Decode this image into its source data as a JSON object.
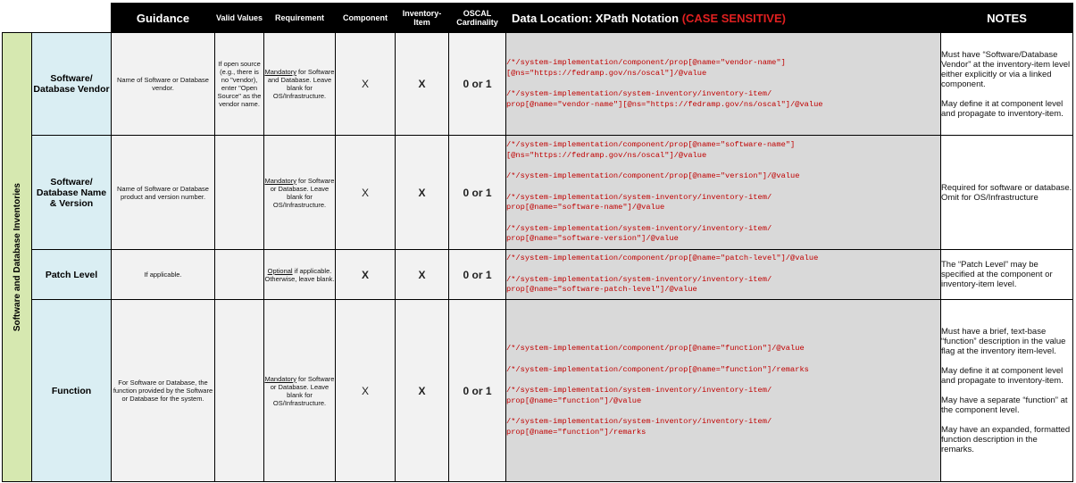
{
  "header": {
    "guidance": "Guidance",
    "valid_values": "Valid Values",
    "requirement": "Requirement",
    "component": "Component",
    "inventory_item": "Inventory-Item",
    "oscal_cardinality": "OSCAL Cardinality",
    "xpath_title": "Data Location: XPath Notation",
    "xpath_case": "(CASE SENSITIVE)",
    "notes": "NOTES"
  },
  "section_label": "Software and Database Inventories",
  "rows": [
    {
      "name": "Software/ Database Vendor",
      "guidance": "Name of Software or Database vendor.",
      "valid_values": "If open source (e.g., there is no \"vendor), enter \"Open Source\" as the vendor name.",
      "req_keyword": "Mandatory",
      "req_rest": " for Software and Database. Leave blank for OS/Infrastructure.",
      "component": "X",
      "inventory": "X",
      "cardinality": "0 or 1",
      "xpaths": [
        "/*/system-implementation/component/prop[@name=\"vendor-name\"]\n[@ns=\"https://fedramp.gov/ns/oscal\"]/@value",
        "/*/system-implementation/system-inventory/inventory-item/\nprop[@name=\"vendor-name\"][@ns=\"https://fedramp.gov/ns/oscal\"]/@value"
      ],
      "notes": [
        "Must have “Software/Database Vendor” at the inventory-item level either explicitly or via a linked component.",
        "May define it at component level and propagate to inventory-item."
      ]
    },
    {
      "name": "Software/ Database Name & Version",
      "guidance": "Name of Software or Database product and version number.",
      "valid_values": "",
      "req_keyword": "Mandatory",
      "req_rest": " for Software or Database. Leave blank for OS/Infrastructure.",
      "component": "X",
      "inventory": "X",
      "cardinality": "0 or 1",
      "xpaths": [
        "/*/system-implementation/component/prop[@name=\"software-name\"]\n[@ns=\"https://fedramp.gov/ns/oscal\"]/@value",
        "/*/system-implementation/component/prop[@name=\"version\"]/@value",
        "/*/system-implementation/system-inventory/inventory-item/\nprop[@name=\"software-name\"]/@value",
        "/*/system-implementation/system-inventory/inventory-item/\nprop[@name=\"software-version\"]/@value"
      ],
      "notes": [
        "Required for software or database. Omit for OS/Infrastructure"
      ]
    },
    {
      "name": "Patch Level",
      "guidance": "If applicable.",
      "valid_values": "",
      "req_keyword": "Optional",
      "req_rest": " if applicable. Otherwise, leave blank.",
      "component": "X",
      "inventory": "X",
      "cardinality": "0 or 1",
      "xpaths": [
        "/*/system-implementation/component/prop[@name=\"patch-level\"]/@value",
        "/*/system-implementation/system-inventory/inventory-item/\nprop[@name=\"software-patch-level\"]/@value"
      ],
      "notes": [
        "The “Patch Level” may be specified at the component or inventory-item level."
      ]
    },
    {
      "name": "Function",
      "guidance": "For Software or Database, the function provided by the Software or Database for the system.",
      "valid_values": "",
      "req_keyword": "Mandatory",
      "req_rest": " for Software or Database. Leave blank for OS/Infrastructure.",
      "component": "X",
      "inventory": "X",
      "cardinality": "0 or 1",
      "xpaths": [
        "/*/system-implementation/component/prop[@name=\"function\"]/@value",
        "/*/system-implementation/component/prop[@name=\"function\"]/remarks",
        "/*/system-implementation/system-inventory/inventory-item/\nprop[@name=\"function\"]/@value",
        "/*/system-implementation/system-inventory/inventory-item/\nprop[@name=\"function\"]/remarks"
      ],
      "notes": [
        "Must have a brief, text-base “function” description in the value flag at the inventory item-level.",
        "May define it at component level and propagate to inventory-item.",
        "May have a separate “function” at the component level.",
        "May have an expanded, formatted function description in the remarks."
      ]
    }
  ]
}
